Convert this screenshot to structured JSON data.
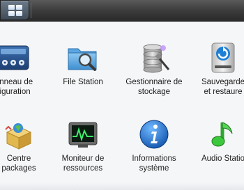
{
  "taskbar": {
    "main_menu_icon": "grid-icon"
  },
  "apps": [
    {
      "label": "anneau de\nfiguration",
      "icon": "control-panel-icon"
    },
    {
      "label": "File Station",
      "icon": "file-station-icon"
    },
    {
      "label": "Gestionnaire de\nstockage",
      "icon": "storage-manager-icon"
    },
    {
      "label": "Sauvegarde\net restaure",
      "icon": "backup-restore-icon"
    },
    {
      "label": "Centre\npackages",
      "icon": "package-center-icon"
    },
    {
      "label": "Moniteur de\nressources",
      "icon": "resource-monitor-icon"
    },
    {
      "label": "Informations\nsystème",
      "icon": "info-icon"
    },
    {
      "label": "Audio Statio",
      "icon": "audio-station-icon"
    }
  ]
}
